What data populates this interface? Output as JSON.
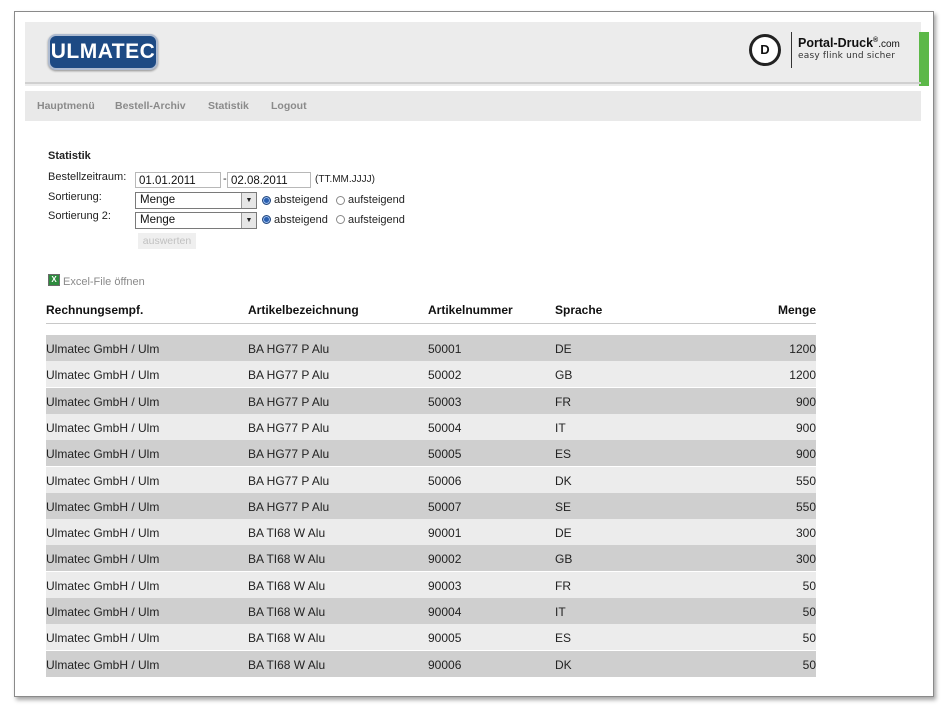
{
  "header": {
    "logo_text": "ULMATEC",
    "brand_icon": "D",
    "brand_name": "Portal-Druck",
    "brand_reg": "®",
    "brand_tld": ".com",
    "brand_tagline": "easy flink und sicher"
  },
  "nav": {
    "items": [
      "Hauptmenü",
      "Bestell-Archiv",
      "Statistik",
      "Logout"
    ]
  },
  "form": {
    "title": "Statistik",
    "period_label": "Bestellzeitraum:",
    "date_from": "01.01.2011",
    "date_sep": "-",
    "date_to": "02.08.2011",
    "date_format": "(TT.MM.JJJJ)",
    "sort1_label": "Sortierung:",
    "sort1_value": "Menge",
    "sort1_order": "absteigend",
    "sort2_label": "Sortierung 2:",
    "sort2_value": "Menge",
    "sort2_order": "absteigend",
    "order_desc": "absteigend",
    "order_asc": "aufsteigend",
    "submit_label": "auswerten"
  },
  "excel": {
    "link_text": "Excel-File öffnen"
  },
  "table": {
    "columns": [
      "Rechnungsempf.",
      "Artikelbezeichnung",
      "Artikelnummer",
      "Sprache",
      "Menge"
    ],
    "rows": [
      [
        "Ulmatec GmbH / Ulm",
        "BA HG77 P Alu",
        "50001",
        "DE",
        "1200"
      ],
      [
        "Ulmatec GmbH / Ulm",
        "BA HG77 P Alu",
        "50002",
        "GB",
        "1200"
      ],
      [
        "Ulmatec GmbH / Ulm",
        "BA HG77 P Alu",
        "50003",
        "FR",
        "900"
      ],
      [
        "Ulmatec GmbH / Ulm",
        "BA HG77 P Alu",
        "50004",
        "IT",
        "900"
      ],
      [
        "Ulmatec GmbH / Ulm",
        "BA HG77 P Alu",
        "50005",
        "ES",
        "900"
      ],
      [
        "Ulmatec GmbH / Ulm",
        "BA HG77 P Alu",
        "50006",
        "DK",
        "550"
      ],
      [
        "Ulmatec GmbH / Ulm",
        "BA HG77 P Alu",
        "50007",
        "SE",
        "550"
      ],
      [
        "Ulmatec GmbH / Ulm",
        "BA TI68 W Alu",
        "90001",
        "DE",
        "300"
      ],
      [
        "Ulmatec GmbH / Ulm",
        "BA TI68 W Alu",
        "90002",
        "GB",
        "300"
      ],
      [
        "Ulmatec GmbH / Ulm",
        "BA TI68 W Alu",
        "90003",
        "FR",
        "50"
      ],
      [
        "Ulmatec GmbH / Ulm",
        "BA TI68 W Alu",
        "90004",
        "IT",
        "50"
      ],
      [
        "Ulmatec GmbH / Ulm",
        "BA TI68 W Alu",
        "90005",
        "ES",
        "50"
      ],
      [
        "Ulmatec GmbH / Ulm",
        "BA TI68 W Alu",
        "90006",
        "DK",
        "50"
      ]
    ]
  },
  "colors": {
    "logo_bg": "#1d4a84",
    "accent_green": "#5cb848",
    "row_dark": "#cfcfcf",
    "row_light": "#ececec"
  }
}
